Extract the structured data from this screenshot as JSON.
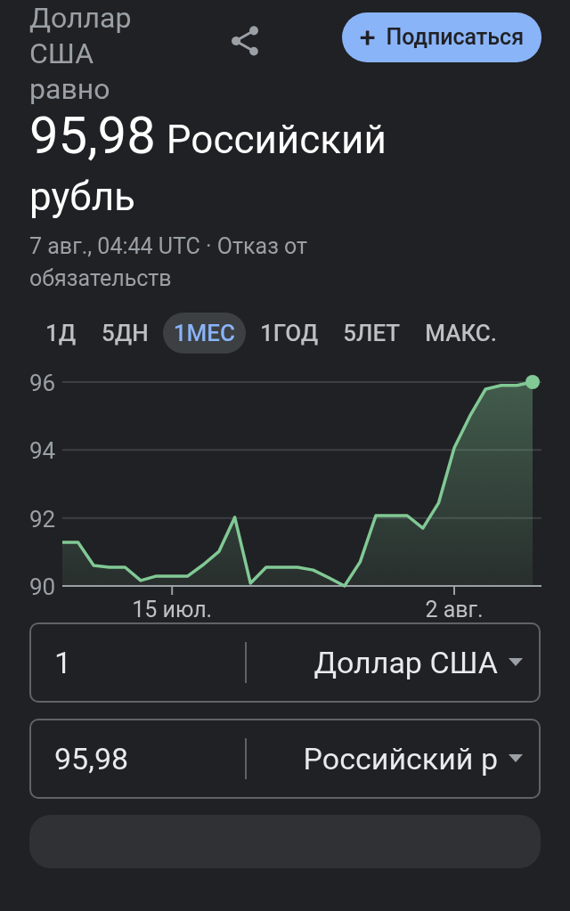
{
  "header": {
    "title": "Доллар США равно",
    "subscribe": "Подписаться",
    "subscribe_icon": "+"
  },
  "rate": {
    "value": "95,98",
    "currency": "Российский рубль"
  },
  "timestamp": "7 авг., 04:44 UTC · Отказ от обязательств",
  "ranges": [
    {
      "label": "1Д",
      "selected": false
    },
    {
      "label": "5ДН",
      "selected": false
    },
    {
      "label": "1МЕС",
      "selected": true
    },
    {
      "label": "1ГОД",
      "selected": false
    },
    {
      "label": "5ЛЕТ",
      "selected": false
    },
    {
      "label": "МАКС.",
      "selected": false
    }
  ],
  "chart": {
    "chart_data": {
      "type": "area",
      "categories": [
        null,
        null,
        null,
        null,
        null,
        null,
        null,
        "15 июл.",
        null,
        null,
        null,
        null,
        null,
        null,
        null,
        null,
        null,
        null,
        null,
        null,
        null,
        null,
        null,
        null,
        null,
        "2 авг.",
        null,
        null,
        null,
        null,
        null
      ],
      "series": [
        {
          "color": "#81c995",
          "values": [
            91.28,
            91.28,
            90.6,
            90.55,
            90.55,
            90.16,
            90.29,
            90.29,
            90.29,
            90.63,
            91.02,
            92.02,
            90.08,
            90.55,
            90.55,
            90.55,
            90.47,
            90.24,
            90.0,
            90.71,
            92.07,
            92.07,
            92.07,
            91.7,
            92.44,
            94.06,
            95.0,
            95.79,
            95.9,
            95.9,
            96.0
          ]
        }
      ],
      "ylim": [
        90,
        96
      ],
      "yticks": [
        90,
        92,
        94,
        96
      ]
    }
  },
  "converter": [
    {
      "amount": "1",
      "currency": "Доллар США"
    },
    {
      "amount": "95,98",
      "currency": "Российский р"
    }
  ]
}
